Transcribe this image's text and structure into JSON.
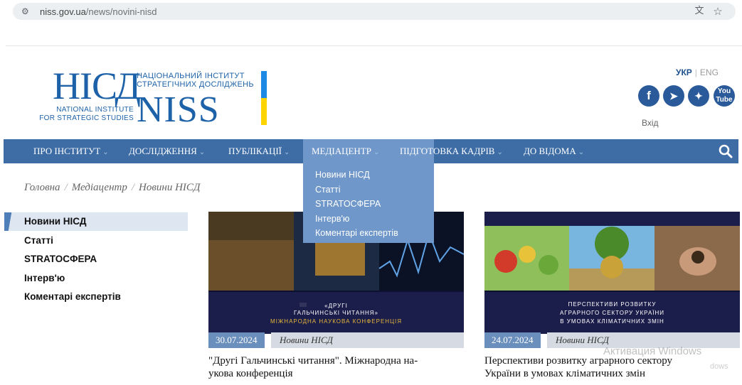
{
  "browser": {
    "url_host": "niss.gov.ua",
    "url_path": "/news/novini-nisd",
    "site_info_icon": "tune-icon",
    "translate_icon": "translate-icon",
    "bookmark_icon": "star-icon"
  },
  "logo": {
    "abbr_ua": "НІСД",
    "name_ua_line1": "НАЦІОНАЛЬНИЙ ІНСТИТУТ",
    "name_ua_line2": "СТРАТЕГІЧНИХ ДОСЛІДЖЕНЬ",
    "name_en_line1": "NATIONAL INSTITUTE",
    "name_en_line2": "FOR STRATEGIC STUDIES",
    "abbr_en": "NISS"
  },
  "header": {
    "lang_active": "УКР",
    "lang_sep": "|",
    "lang_other": "ENG",
    "login": "Вхід",
    "socials": [
      {
        "icon": "facebook-icon",
        "glyph": "f"
      },
      {
        "icon": "telegram-icon",
        "glyph": "➤"
      },
      {
        "icon": "twitter-icon",
        "glyph": "✦"
      },
      {
        "icon": "youtube-icon",
        "glyph": "You Tube"
      }
    ]
  },
  "nav": {
    "items": [
      {
        "label": "Про інститут"
      },
      {
        "label": "Дослідження"
      },
      {
        "label": "Публікації"
      },
      {
        "label": "Медіацентр"
      },
      {
        "label": "Підготовка кадрів"
      },
      {
        "label": "До відома"
      }
    ],
    "caret": "⌄",
    "search_icon": "search-icon",
    "dropdown": [
      "Новини НІСД",
      "Статті",
      "STRATOCФЕРА",
      "Інтерв'ю",
      "Коментарі експертів"
    ]
  },
  "breadcrumb": {
    "items": [
      "Головна",
      "Медіацентр",
      "Новини НІСД"
    ],
    "sep": "/"
  },
  "sidebar": {
    "items": [
      "Новини НІСД",
      "Статті",
      "STRATOCФЕРА",
      "Інтерв'ю",
      "Коментарі експертів"
    ]
  },
  "cards": [
    {
      "date": "30.07.2024",
      "category": "Новини НІСД",
      "title": "\"Другі Гальчинські читання\". Міжнародна на-укова конференція",
      "title_line1": "\"Другі Гальчинські читання\". Міжнародна на-",
      "title_line2": "укова конференція",
      "poster_line1": "«ДРУГІ",
      "poster_line2": "ГАЛЬЧИНСЬКІ ЧИТАННЯ»",
      "poster_line3": "МІЖНАРОДНА НАУКОВА КОНФЕРЕНЦІЯ"
    },
    {
      "date": "24.07.2024",
      "category": "Новини НІСД",
      "title_line1": "Перспективи розвитку аграрного сектору",
      "title_line2": "України в умовах кліматичних змін",
      "poster_line1": "ПЕРСПЕКТИВИ РОЗВИТКУ",
      "poster_line2": "АГРАРНОГО СЕКТОРУ УКРАЇНИ",
      "poster_line3": "В УМОВАХ КЛІМАТИЧНИХ ЗМІН"
    }
  ],
  "watermark": {
    "line1": "Активация Windows",
    "line2": "dows"
  }
}
